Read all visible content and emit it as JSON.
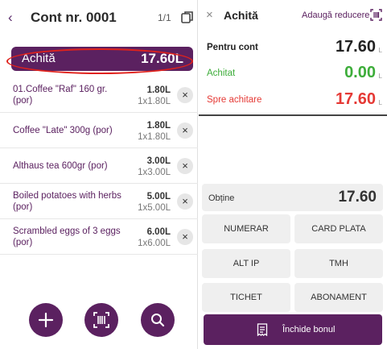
{
  "left": {
    "title": "Cont nr. 0001",
    "page_indicator": "1/1",
    "pay_label": "Achită",
    "pay_amount": "17.60L",
    "items": [
      {
        "name": "01.Coffee \"Raf\" 160 gr. (por)",
        "price": "1.80L",
        "qty": "1x1.80L"
      },
      {
        "name": "Coffee \"Late\" 300g (por)",
        "price": "1.80L",
        "qty": "1x1.80L"
      },
      {
        "name": "Althaus tea 600gr (por)",
        "price": "3.00L",
        "qty": "1x3.00L"
      },
      {
        "name": "Boiled potatoes with herbs (por)",
        "price": "5.00L",
        "qty": "1x5.00L"
      },
      {
        "name": "Scrambled eggs of 3 eggs (por)",
        "price": "6.00L",
        "qty": "1x6.00L"
      }
    ],
    "delete_glyph": "×",
    "back_glyph": "‹"
  },
  "right": {
    "close_glyph": "×",
    "title": "Achită",
    "discount_label": "Adaugă reducere",
    "summary": [
      {
        "label": "Pentru cont",
        "value": "17.60",
        "currency": "L",
        "color": "#222222"
      },
      {
        "label": "Achitat",
        "value": "0.00",
        "currency": "L",
        "color": "#3dad3a"
      },
      {
        "label": "Spre achitare",
        "value": "17.60",
        "currency": "L",
        "color": "#e53935"
      }
    ],
    "obtine_label": "Obține",
    "obtine_value": "17.60",
    "methods": [
      "NUMERAR",
      "CARD PLATA",
      "ALT IP",
      "TMH",
      "TICHET",
      "ABONAMENT"
    ],
    "close_label": "Închide bonul"
  },
  "colors": {
    "brand": "#5b2160",
    "highlight_ring": "#e0221c"
  },
  "icons": [
    "chevron-left-icon",
    "copy-icon",
    "close-icon",
    "plus-icon",
    "barcode-icon",
    "search-icon",
    "receipt-icon"
  ]
}
